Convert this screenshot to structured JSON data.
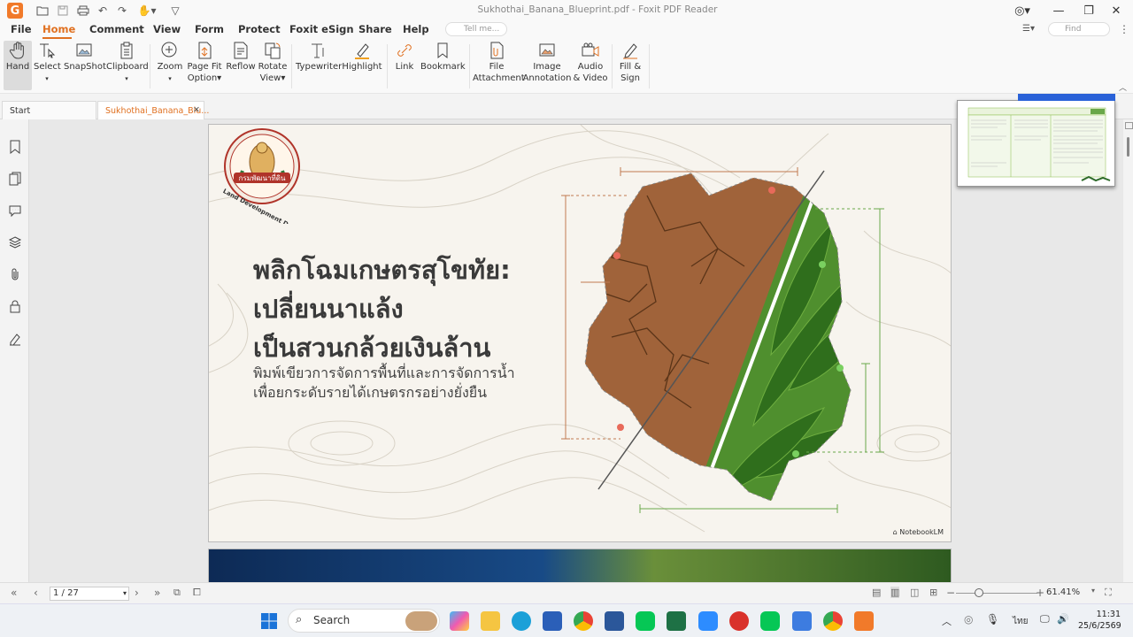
{
  "window": {
    "title": "Sukhothai_Banana_Blueprint.pdf - Foxit PDF Reader",
    "app_logo": "G"
  },
  "menu": {
    "items": [
      "File",
      "Home",
      "Comment",
      "View",
      "Form",
      "Protect",
      "Foxit eSign",
      "Share",
      "Help"
    ],
    "active": "Home",
    "tell_me_placeholder": "Tell me...",
    "find_placeholder": "Find"
  },
  "ribbon": {
    "hand": "Hand",
    "select": "Select",
    "snapshot": "SnapShot",
    "clipboard": "Clipboard",
    "zoom": "Zoom",
    "page_fit": "Page Fit",
    "page_fit_2": "Option",
    "reflow": "Reflow",
    "rotate": "Rotate",
    "rotate_2": "View",
    "typewriter": "Typewriter",
    "highlight": "Highlight",
    "link": "Link",
    "bookmark": "Bookmark",
    "file_attachment": "File",
    "file_attachment_2": "Attachment",
    "image_annotation": "Image",
    "image_annotation_2": "Annotation",
    "audio_video": "Audio",
    "audio_video_2": "& Video",
    "fill_sign": "Fill &",
    "fill_sign_2": "Sign"
  },
  "tabs": [
    {
      "label": "Start"
    },
    {
      "label": "Sukhothai_Banana_Blu..."
    }
  ],
  "slide": {
    "logo_text": "Land Development Department",
    "logo_banner": "กรมพัฒนาที่ดิน",
    "title": "พลิกโฉมเกษตรสุโขทัย:\nเปลี่ยนนาแล้ง\nเป็นสวนกล้วยเงินล้าน",
    "subtitle": "พิมพ์เขียวการจัดการพื้นที่และการจัดการน้ำ\nเพื่อยกระดับรายได้เกษตรกรอย่างยั่งยืน",
    "watermark": "NotebookLM"
  },
  "status": {
    "page_indicator": "1 / 27",
    "zoom": "61.41%"
  },
  "taskbar": {
    "search_placeholder": "Search",
    "language": "ไทย",
    "time": "11:31",
    "date": "25/6/2569"
  },
  "colors": {
    "accent": "#e07020",
    "slide_bg": "#f7f4ee",
    "leaf_green": "#3f7d2a",
    "soil_brown": "#a0633a"
  }
}
